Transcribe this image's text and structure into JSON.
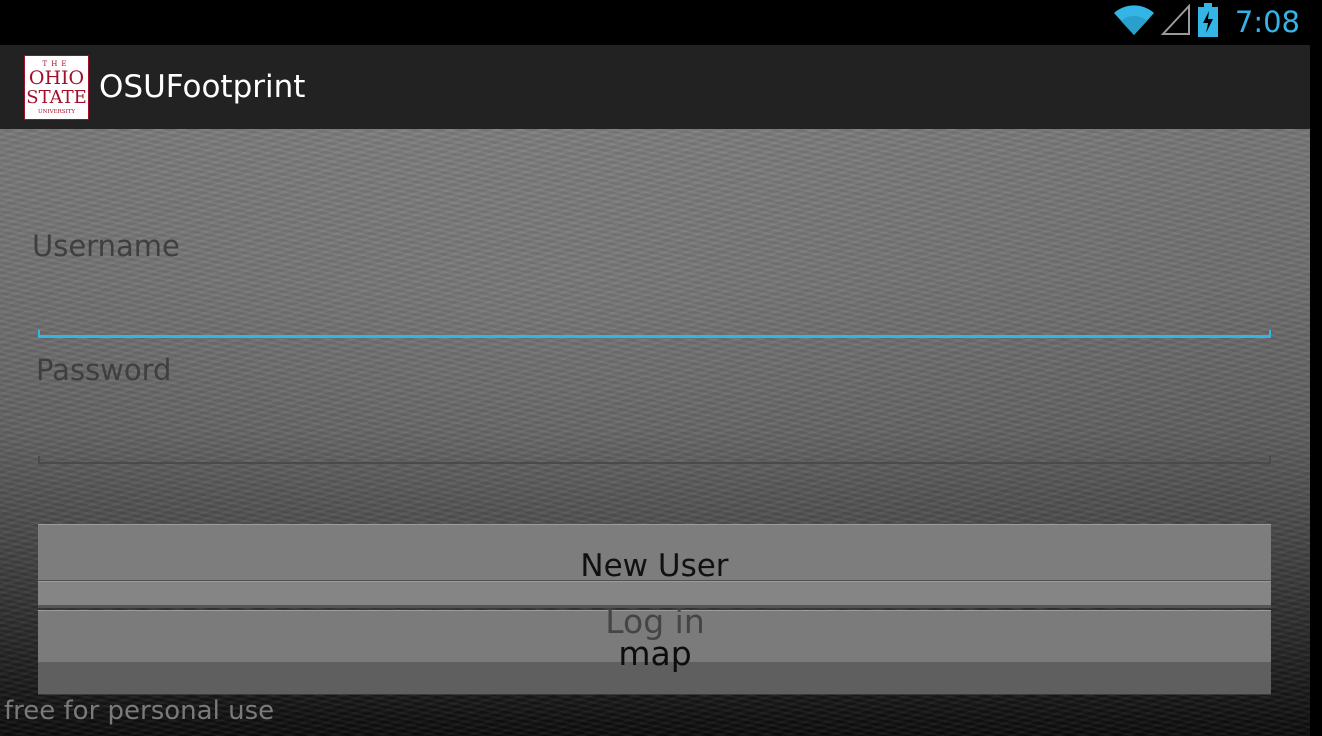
{
  "status_bar": {
    "time": "7:08",
    "icons": [
      "wifi-icon",
      "signal-icon",
      "battery-charging-icon"
    ],
    "accent_color": "#33b5e5"
  },
  "app_bar": {
    "title": "OSUFootprint",
    "logo": {
      "name": "ohio-state-logo",
      "text_lines": [
        "THE",
        "OHIO",
        "STATE",
        "UNIVERSITY"
      ],
      "color": "#a0102a"
    }
  },
  "form": {
    "username": {
      "label": "Username",
      "value": ""
    },
    "password": {
      "label": "Password",
      "value": ""
    }
  },
  "buttons": {
    "new_user": "New User",
    "login": "Log in",
    "map": "map"
  },
  "footer": {
    "note": "free for personal use"
  }
}
